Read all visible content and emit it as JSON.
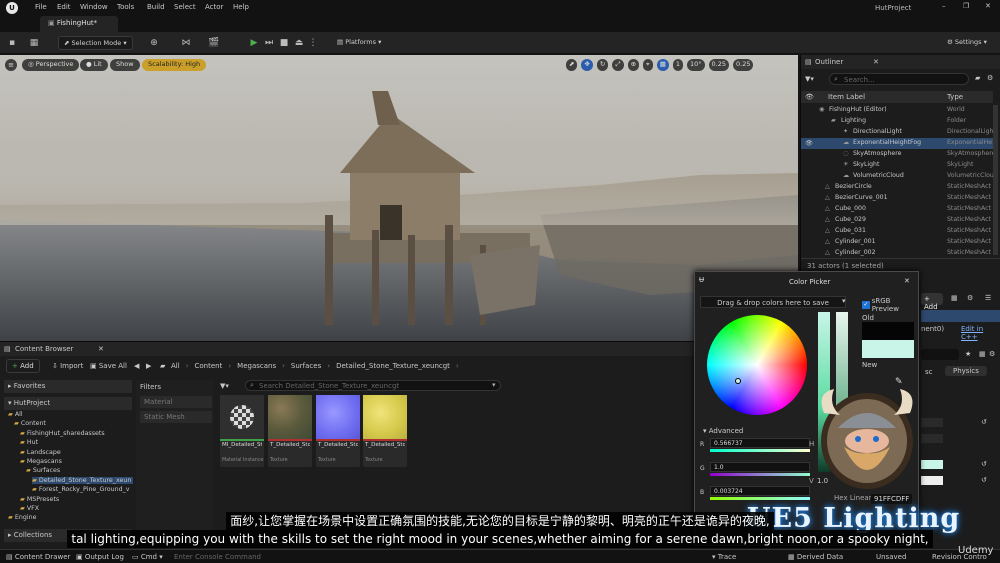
{
  "menubar": {
    "items": [
      "File",
      "Edit",
      "Window",
      "Tools",
      "Build",
      "Select",
      "Actor",
      "Help"
    ],
    "project": "HutProject"
  },
  "tab": {
    "label": "FishingHut*"
  },
  "toolbar": {
    "mode": "Selection Mode",
    "platforms": "Platforms",
    "settings": "Settings"
  },
  "viewport": {
    "perspective": "Perspective",
    "lit": "Lit",
    "show": "Show",
    "scalability": "Scalability: High",
    "grid": "10°",
    "snap1": "1",
    "snap2": "0.25",
    "snap3": "0.25"
  },
  "outliner": {
    "title": "Outliner",
    "search_placeholder": "Search...",
    "col_label": "Item Label",
    "col_type": "Type",
    "rows": [
      {
        "name": "FishingHut (Editor)",
        "type": "World"
      },
      {
        "name": "Lighting",
        "type": "Folder"
      },
      {
        "name": "DirectionalLight",
        "type": "DirectionalLigh"
      },
      {
        "name": "ExponentialHeightFog",
        "type": "ExponentialHe"
      },
      {
        "name": "SkyAtmosphere",
        "type": "SkyAtmosphere"
      },
      {
        "name": "SkyLight",
        "type": "SkyLight"
      },
      {
        "name": "VolumetricCloud",
        "type": "VolumetricCloud"
      },
      {
        "name": "BezierCircle",
        "type": "StaticMeshAct"
      },
      {
        "name": "BezierCurve_001",
        "type": "StaticMeshAct"
      },
      {
        "name": "Cube_000",
        "type": "StaticMeshAct"
      },
      {
        "name": "Cube_029",
        "type": "StaticMeshAct"
      },
      {
        "name": "Cube_031",
        "type": "StaticMeshAct"
      },
      {
        "name": "Cylinder_001",
        "type": "StaticMeshAct"
      },
      {
        "name": "Cylinder_002",
        "type": "StaticMeshAct"
      }
    ],
    "count": "31 actors (1 selected)"
  },
  "details": {
    "add": "Add",
    "component": "nent0)",
    "edit_cpp": "Edit in C++",
    "physics": "Physics",
    "tab_sc": "sc"
  },
  "content_browser": {
    "title": "Content Browser",
    "add": "Add",
    "import": "Import",
    "save_all": "Save All",
    "path": [
      "All",
      "Content",
      "Megascans",
      "Surfaces",
      "Detailed_Stone_Texture_xeuncgt"
    ],
    "favorites": "Favorites",
    "project": "HutProject",
    "filters": "Filters",
    "filter_items": [
      "Material",
      "Static Mesh"
    ],
    "search_placeholder": "Search Detailed_Stone_Texture_xeuncgt",
    "tree": [
      "All",
      "Content",
      "FishingHut_sharedassets",
      "Hut",
      "Landscape",
      "Megascans",
      "Surfaces",
      "Detailed_Stone_Texture_xeun",
      "Forest_Rocky_Pine_Ground_v",
      "MSPresets",
      "VFX",
      "Engine"
    ],
    "collections": "Collections",
    "assets": [
      {
        "name": "MI_Detailed_Stone_Texture_",
        "type": "Material Instance",
        "color": "#3fa04a"
      },
      {
        "name": "T_Detailed_Stone_Texture_",
        "type": "Texture",
        "color": "#b03030"
      },
      {
        "name": "T_Detailed_Stone_Texture_",
        "type": "Texture",
        "color": "#b03030"
      },
      {
        "name": "T_Detailed_StoneTexture_",
        "type": "Texture",
        "color": "#b03030"
      }
    ]
  },
  "status_bar": {
    "drawer": "Content Drawer",
    "output": "Output Log",
    "cmd": "Cmd",
    "console_placeholder": "Enter Console Command",
    "trace": "Trace",
    "derived": "Derived Data",
    "unsaved": "Unsaved",
    "revision": "Revision Contro"
  },
  "color_picker": {
    "title": "Color Picker",
    "drop": "Drag & drop colors here to save",
    "srgb": "sRGB Preview",
    "old": "Old",
    "new": "New",
    "advanced": "Advanced",
    "r": "0.566737",
    "g": "1.0",
    "b": "0.003724",
    "v": "1.0",
    "hex_label": "Hex Linear",
    "hex": "91FFCDFF",
    "new_color": "#c8f5e8"
  },
  "overlay": {
    "logo": "UE5 Lighting",
    "watermark": "Udemy"
  },
  "subtitles": {
    "line1": "面纱,让您掌握在场景中设置正确氛围的技能,无论您的目标是宁静的黎明、明亮的正午还是诡异的夜晚,",
    "line2": "tal lighting,equipping you with the skills to set the right mood in your scenes,whether aiming for a serene dawn,bright noon,or a spooky night,"
  }
}
